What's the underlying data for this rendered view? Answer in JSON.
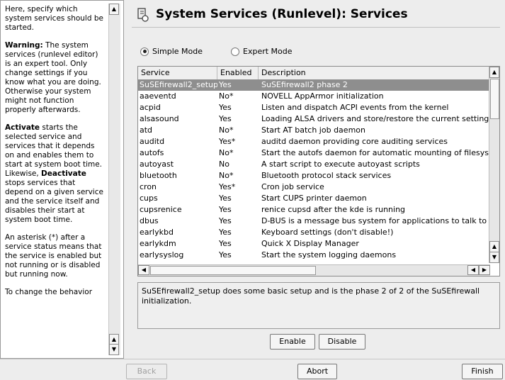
{
  "help": {
    "p1": "Here, specify which system services should be started.",
    "p2_bold": "Warning:",
    "p2": " The system services (runlevel editor) is an expert tool. Only change settings if you know what you are doing. Otherwise your system might not function properly afterwards.",
    "p3_bold1": "Activate",
    "p3a": " starts the selected service and services that it depends on and enables them to start at system boot time. Likewise, ",
    "p3_bold2": "Deactivate",
    "p3b": " stops services that depend on a given service and the service itself and disables their start at system boot time.",
    "p4": "An asterisk (*) after a service status means that the service is enabled but not running or is disabled but running now.",
    "p5": "To change the behavior"
  },
  "title": "System Services (Runlevel): Services",
  "modes": {
    "simple": "Simple Mode",
    "expert": "Expert Mode",
    "selected": "simple"
  },
  "table": {
    "headers": [
      "Service",
      "Enabled",
      "Description"
    ],
    "rows": [
      [
        "SuSEfirewall2_setup",
        "Yes",
        "SuSEfirewall2 phase 2"
      ],
      [
        "aaeventd",
        "No*",
        "NOVELL AppArmor initialization"
      ],
      [
        "acpid",
        "Yes",
        "Listen and dispatch ACPI events from the kernel"
      ],
      [
        "alsasound",
        "Yes",
        "Loading ALSA drivers and store/restore the current setting"
      ],
      [
        "atd",
        "No*",
        "Start AT batch job daemon"
      ],
      [
        "auditd",
        "Yes*",
        "auditd daemon providing core auditing services"
      ],
      [
        "autofs",
        "No*",
        "Start the autofs daemon for automatic mounting of filesystem"
      ],
      [
        "autoyast",
        "No",
        "A start script to execute autoyast scripts"
      ],
      [
        "bluetooth",
        "No*",
        "Bluetooth protocol stack services"
      ],
      [
        "cron",
        "Yes*",
        "Cron job service"
      ],
      [
        "cups",
        "Yes",
        "Start CUPS printer daemon"
      ],
      [
        "cupsrenice",
        "Yes",
        "renice cupsd after the kde is running"
      ],
      [
        "dbus",
        "Yes",
        "D-BUS is a message bus system for applications to talk to or"
      ],
      [
        "earlykbd",
        "Yes",
        "Keyboard settings (don't disable!)"
      ],
      [
        "earlykdm",
        "Yes",
        "Quick X Display Manager"
      ],
      [
        "earlysyslog",
        "Yes",
        "Start the system logging daemons"
      ]
    ],
    "selected_index": 0
  },
  "description": "SuSEfirewall2_setup does some basic setup and is the phase 2 of 2 of the SuSEfirewall initialization.",
  "buttons": {
    "enable": "Enable",
    "disable": "Disable",
    "back": "Back",
    "abort": "Abort",
    "finish": "Finish"
  }
}
